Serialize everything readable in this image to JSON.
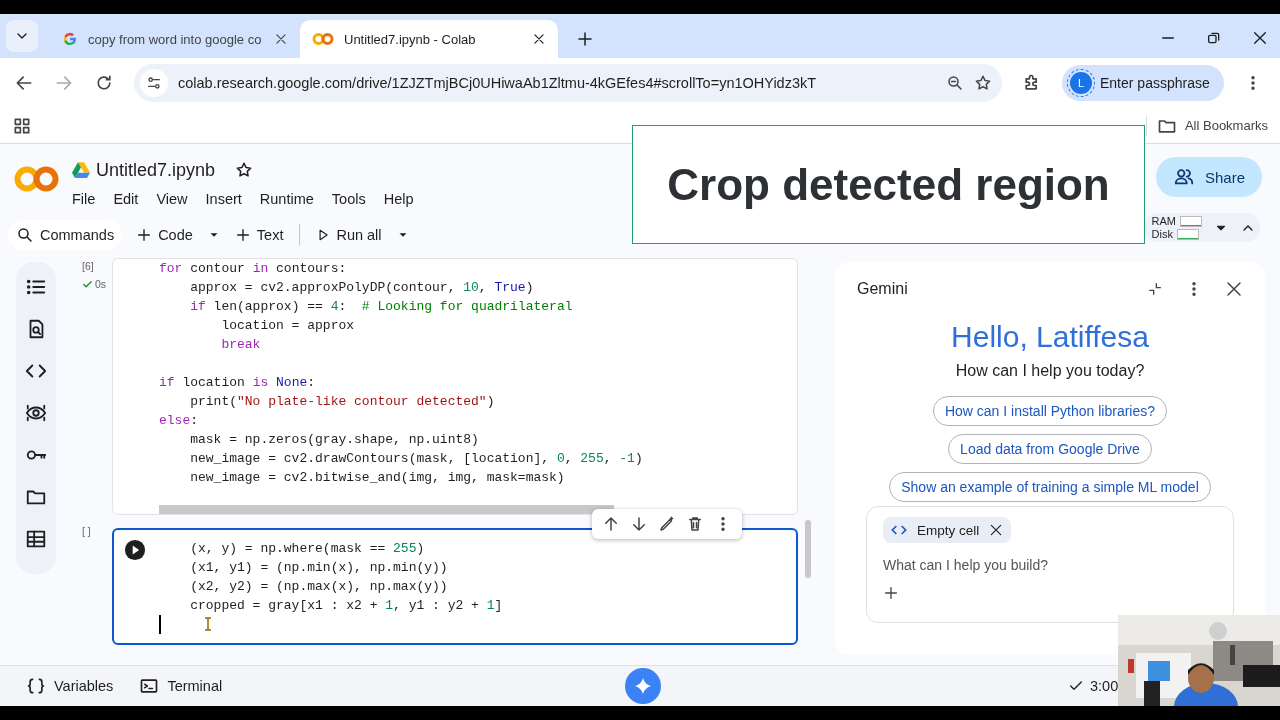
{
  "browser": {
    "tabs": [
      {
        "title": "copy from word into google co",
        "selected": false
      },
      {
        "title": "Untitled7.ipynb - Colab",
        "selected": true
      }
    ],
    "url": "colab.research.google.com/drive/1ZJZTmjBCj0UHiwaAb1Zltmu-4kGEfes4#scrollTo=yn1OHYidz3kT",
    "profile_button": "Enter passphrase",
    "avatar_letter": "L",
    "bookmarks": "All Bookmarks"
  },
  "notebook": {
    "title": "Untitled7.ipynb",
    "menu": [
      "File",
      "Edit",
      "View",
      "Insert",
      "Runtime",
      "Tools",
      "Help"
    ],
    "toolbar": [
      {
        "label": "Commands",
        "kind": "search",
        "dropdown": false
      },
      {
        "label": "Code",
        "kind": "add",
        "dropdown": true
      },
      {
        "label": "Text",
        "kind": "add",
        "dropdown": false
      },
      {
        "label": "Run all",
        "kind": "run",
        "dropdown": true
      }
    ],
    "share": "Share",
    "resources": [
      "RAM",
      "Disk"
    ]
  },
  "overlay_caption": "Crop detected region",
  "cells": [
    {
      "execution_count": "[6]",
      "status": "0s",
      "active": false,
      "blocks": [
        {
          "lines": [
            {
              "tokens": [
                {
                  "t": "for",
                  "kind": "keyword"
                },
                {
                  "t": " contour ",
                  "kind": "plain"
                },
                {
                  "t": "in",
                  "kind": "keyword"
                },
                {
                  "t": " contours:",
                  "kind": "plain"
                }
              ]
            },
            {
              "tokens": [
                {
                  "t": "    approx = cv2.approxPolyDP(contour, ",
                  "kind": "plain"
                },
                {
                  "t": "10",
                  "kind": "number"
                },
                {
                  "t": ", ",
                  "kind": "plain"
                },
                {
                  "t": "True",
                  "kind": "constant"
                },
                {
                  "t": ")",
                  "kind": "plain"
                }
              ]
            },
            {
              "tokens": [
                {
                  "t": "    if",
                  "kind": "keyword"
                },
                {
                  "t": " len(approx) == ",
                  "kind": "plain"
                },
                {
                  "t": "4",
                  "kind": "number"
                },
                {
                  "t": ":  ",
                  "kind": "plain"
                },
                {
                  "t": "# Looking for quadrilateral",
                  "kind": "comment"
                }
              ]
            },
            {
              "tokens": [
                {
                  "t": "        location = approx",
                  "kind": "plain"
                }
              ]
            },
            {
              "tokens": [
                {
                  "t": "        break",
                  "kind": "keyword"
                }
              ]
            }
          ]
        },
        {
          "lines": [
            {
              "tokens": [
                {
                  "t": "if",
                  "kind": "keyword"
                },
                {
                  "t": " location ",
                  "kind": "plain"
                },
                {
                  "t": "is",
                  "kind": "keyword"
                },
                {
                  "t": " None",
                  "kind": "constant"
                },
                {
                  "t": ":",
                  "kind": "plain"
                }
              ]
            },
            {
              "tokens": [
                {
                  "t": "    print(",
                  "kind": "plain"
                },
                {
                  "t": "\"No plate-like contour detected\"",
                  "kind": "string"
                },
                {
                  "t": ")",
                  "kind": "plain"
                }
              ]
            },
            {
              "tokens": [
                {
                  "t": "else",
                  "kind": "keyword"
                },
                {
                  "t": ":",
                  "kind": "plain"
                }
              ]
            },
            {
              "tokens": [
                {
                  "t": "    mask = np.zeros(gray.shape, np.uint8)",
                  "kind": "plain"
                }
              ]
            },
            {
              "tokens": [
                {
                  "t": "    new_image = cv2.drawContours(mask, [location], ",
                  "kind": "plain"
                },
                {
                  "t": "0",
                  "kind": "number"
                },
                {
                  "t": ", ",
                  "kind": "plain"
                },
                {
                  "t": "255",
                  "kind": "number"
                },
                {
                  "t": ", ",
                  "kind": "plain"
                },
                {
                  "t": "-1",
                  "kind": "number"
                },
                {
                  "t": ")",
                  "kind": "plain"
                }
              ]
            },
            {
              "tokens": [
                {
                  "t": "    new_image = cv2.bitwise_and(img, img, mask=mask)",
                  "kind": "plain"
                }
              ]
            }
          ]
        }
      ]
    },
    {
      "execution_count": "[ ]",
      "active": true,
      "blocks": [
        {
          "lines": [
            {
              "tokens": [
                {
                  "t": "    (x, y) = np.where(mask == ",
                  "kind": "plain"
                },
                {
                  "t": "255",
                  "kind": "number"
                },
                {
                  "t": ")",
                  "kind": "plain"
                }
              ]
            },
            {
              "tokens": [
                {
                  "t": "    (x1, y1) = (np.min(x), np.min(y))",
                  "kind": "plain"
                }
              ]
            },
            {
              "tokens": [
                {
                  "t": "    (x2, y2) = (np.max(x), np.max(y))",
                  "kind": "plain"
                }
              ]
            },
            {
              "tokens": [
                {
                  "t": "    cropped = gray[x1 : x2 + ",
                  "kind": "plain"
                },
                {
                  "t": "1",
                  "kind": "number"
                },
                {
                  "t": ", y1 : y2 + ",
                  "kind": "plain"
                },
                {
                  "t": "1",
                  "kind": "number"
                },
                {
                  "t": "]",
                  "kind": "plain"
                }
              ]
            }
          ]
        }
      ]
    }
  ],
  "gemini": {
    "title": "Gemini",
    "greeting": "Hello, Latiffesa",
    "subtitle": "How can I help you today?",
    "suggestions": [
      "How can I install Python libraries?",
      "Load data from Google Drive",
      "Show an example of training a simple ML model"
    ],
    "context_chip": "Empty cell",
    "placeholder": "What can I help you build?"
  },
  "status_bar": {
    "items": [
      {
        "label": "Variables",
        "kind": "variables"
      },
      {
        "label": "Terminal",
        "kind": "terminal"
      }
    ],
    "time": "3:00"
  }
}
